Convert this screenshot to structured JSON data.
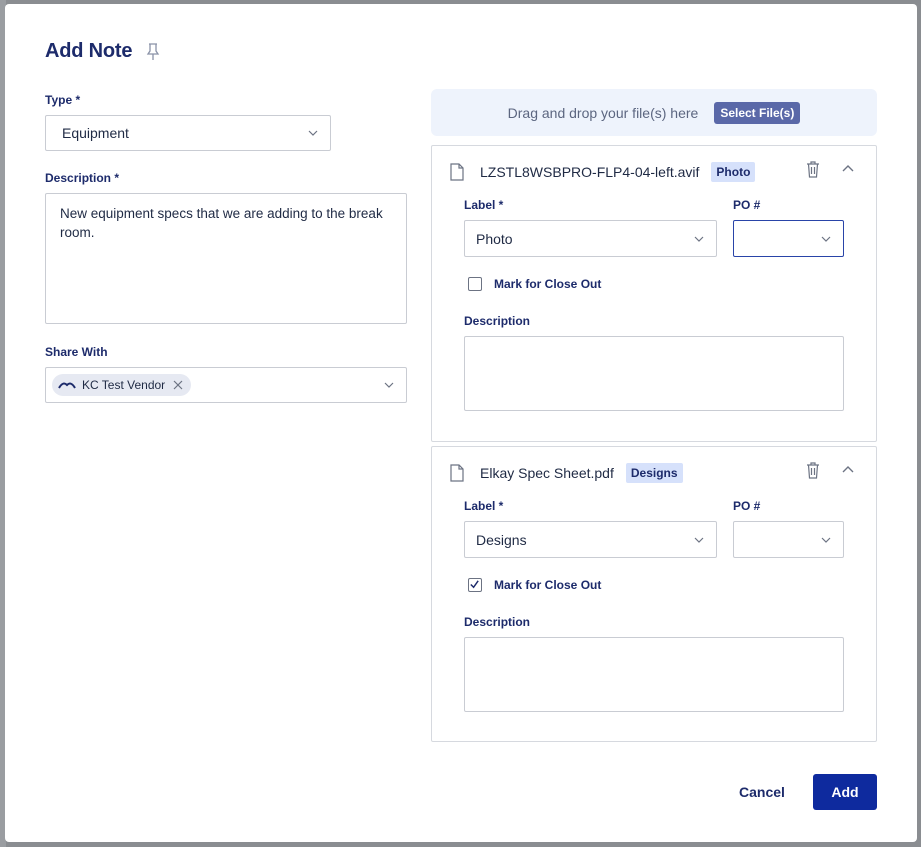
{
  "dialog": {
    "title": "Add Note"
  },
  "form": {
    "type_label": "Type *",
    "type_value": "Equipment",
    "description_label": "Description *",
    "description_value": "New equipment specs that we are adding to the break room.",
    "share_label": "Share With",
    "share_chip": "KC Test Vendor"
  },
  "dropzone": {
    "text": "Drag and drop your file(s) here",
    "button": "Select File(s)"
  },
  "files": [
    {
      "name": "LZSTL8WSBPRO-FLP4-04-left.avif",
      "tag": "Photo",
      "label_label": "Label *",
      "label_value": "Photo",
      "po_label": "PO #",
      "po_value": "",
      "closeout_label": "Mark for Close Out",
      "closeout_checked": false,
      "description_label": "Description"
    },
    {
      "name": "Elkay Spec Sheet.pdf",
      "tag": "Designs",
      "label_label": "Label *",
      "label_value": "Designs",
      "po_label": "PO #",
      "po_value": "",
      "closeout_label": "Mark for Close Out",
      "closeout_checked": true,
      "description_label": "Description"
    }
  ],
  "actions": {
    "cancel": "Cancel",
    "add": "Add"
  },
  "colors": {
    "primary": "#0e2a9e",
    "heading": "#1d2b6b",
    "tag_bg": "#d6e1fb",
    "dropzone_bg": "#eef3fc"
  },
  "icons": [
    "pin-icon",
    "chevron-down-icon",
    "close-icon",
    "file-icon",
    "trash-icon",
    "chevron-up-icon",
    "check-icon",
    "vendor-logo-icon"
  ]
}
